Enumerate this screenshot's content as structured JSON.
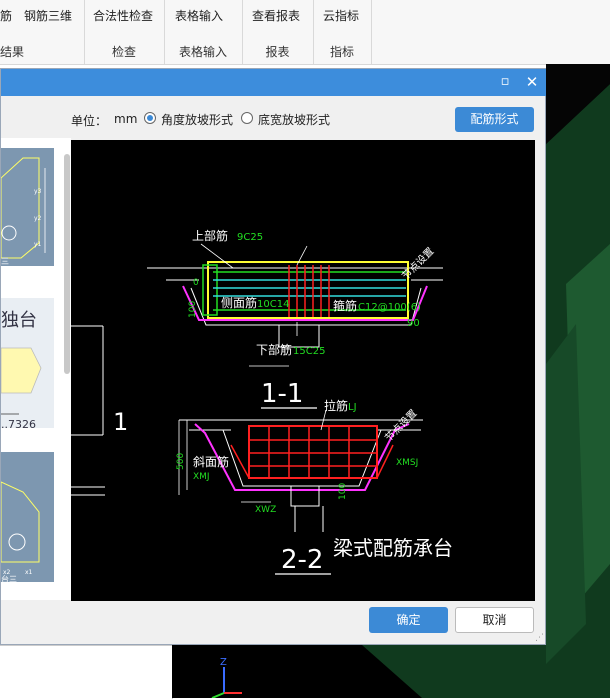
{
  "ribbon": {
    "groups": [
      {
        "buttons": [
          "筋",
          "钢筋三维"
        ],
        "label": "结果"
      },
      {
        "buttons": [
          "合法性检查"
        ],
        "label": "检查"
      },
      {
        "buttons": [
          "表格输入"
        ],
        "label": "表格输入"
      },
      {
        "buttons": [
          "查看报表"
        ],
        "label": "报表"
      },
      {
        "buttons": [
          "云指标"
        ],
        "label": "指标"
      }
    ]
  },
  "dialog": {
    "titlebar": {
      "maximize_icon": "maximize-icon",
      "close_icon": "close-icon"
    },
    "toolbar": {
      "unit_label": "单位：",
      "unit_value": "mm",
      "option_angle": "角度放坡形式",
      "option_width": "底宽放坡形式",
      "selected": "角度放坡形式",
      "rebar_button": "配筋形式"
    },
    "thumbs": [
      {
        "text": "三",
        "dims": [
          "y3",
          "y2",
          "y1"
        ]
      },
      {
        "text": "独台",
        "value": "..7326"
      },
      {
        "text": "台三",
        "dims": [
          "x2",
          "x1"
        ]
      }
    ],
    "drawing": {
      "section_1_1": "1-1",
      "section_2_2": "2-2",
      "label_1": "1",
      "title": "梁式配筋承台",
      "top_bar": "上部筋",
      "top_bar_value": "9C25",
      "side_bar": "侧面筋",
      "side_bar_value": "10C14",
      "stirrup": "箍筋",
      "stirrup_value": "C12@100(6)",
      "bottom_bar": "下部筋",
      "bottom_bar_value": "15C25",
      "tie_bar": "拉筋",
      "tie_bar_value": "LJ",
      "slope_bar": "斜面筋",
      "slope_value": "XMJ",
      "xwz": "XWZ",
      "xmsj": "XMSJ",
      "angle": "90",
      "dim_0": "0",
      "dim_100a": "100",
      "dim_500": "500",
      "dim_100b": "100",
      "slope_label_1": "节点设置",
      "slope_label_2": "节点设置"
    },
    "footer": {
      "ok": "确定",
      "cancel": "取消"
    }
  },
  "colors": {
    "title_blue": "#3d8ddc",
    "button_blue": "#3c8ad6",
    "cad_red": "#ff2020",
    "cad_green": "#22dd22",
    "cad_magenta": "#ff33ff",
    "cad_cyan": "#33dddd",
    "cad_yellow": "#ffff33"
  }
}
